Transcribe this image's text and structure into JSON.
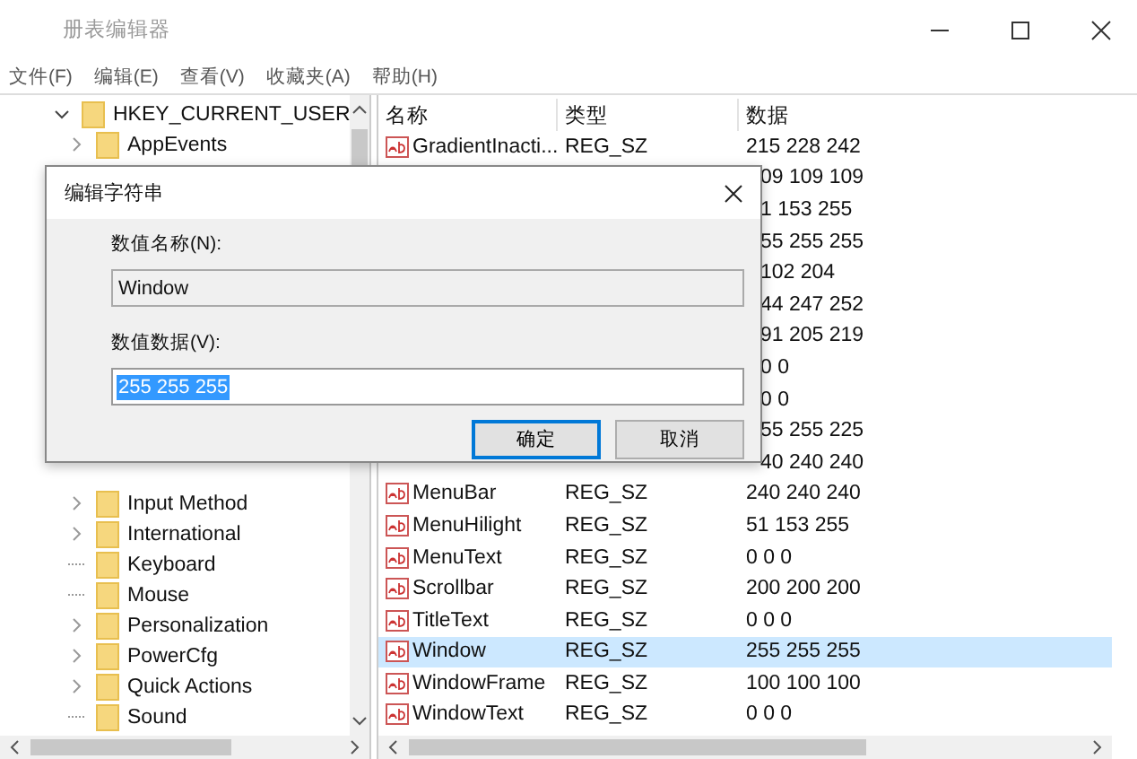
{
  "window": {
    "title": "册表编辑器"
  },
  "menu": [
    "文件(F)",
    "编辑(E)",
    "查看(V)",
    "收藏夹(A)",
    "帮助(H)"
  ],
  "tree": {
    "label": "HKEY_CURRENT_USER",
    "expanded": true,
    "children": [
      {
        "label": "AppEvents",
        "expandable": true
      },
      {
        "label": "Input Method",
        "expandable": true
      },
      {
        "label": "International",
        "expandable": true
      },
      {
        "label": "Keyboard",
        "expandable": false
      },
      {
        "label": "Mouse",
        "expandable": false
      },
      {
        "label": "Personalization",
        "expandable": true
      },
      {
        "label": "PowerCfg",
        "expandable": true
      },
      {
        "label": "Quick Actions",
        "expandable": true
      },
      {
        "label": "Sound",
        "expandable": false
      }
    ]
  },
  "list": {
    "columns": [
      "名称",
      "类型",
      "数据"
    ],
    "rows": [
      {
        "name": "GradientInacti...",
        "type": "REG_SZ",
        "data": "215 228 242",
        "selected": false
      },
      {
        "data": "09 109 109",
        "selected": false
      },
      {
        "data": "1 153 255",
        "selected": false
      },
      {
        "data": "55 255 255",
        "selected": false
      },
      {
        "data": "102 204",
        "selected": false
      },
      {
        "data": "44 247 252",
        "selected": false
      },
      {
        "data": "91 205 219",
        "selected": false
      },
      {
        "data": "0 0",
        "selected": false
      },
      {
        "data": "0 0",
        "selected": false
      },
      {
        "data": "55 255 225",
        "selected": false
      },
      {
        "data": "40 240 240",
        "selected": false
      },
      {
        "name": "MenuBar",
        "type": "REG_SZ",
        "data": "240 240 240",
        "selected": false
      },
      {
        "name": "MenuHilight",
        "type": "REG_SZ",
        "data": "51 153 255",
        "selected": false
      },
      {
        "name": "MenuText",
        "type": "REG_SZ",
        "data": "0 0 0",
        "selected": false
      },
      {
        "name": "Scrollbar",
        "type": "REG_SZ",
        "data": "200 200 200",
        "selected": false
      },
      {
        "name": "TitleText",
        "type": "REG_SZ",
        "data": "0 0 0",
        "selected": false
      },
      {
        "name": "Window",
        "type": "REG_SZ",
        "data": "255 255 255",
        "selected": true
      },
      {
        "name": "WindowFrame",
        "type": "REG_SZ",
        "data": "100 100 100",
        "selected": false
      },
      {
        "name": "WindowText",
        "type": "REG_SZ",
        "data": "0 0 0",
        "selected": false
      }
    ]
  },
  "dialog": {
    "title": "编辑字符串",
    "name_label": "数值名称(N):",
    "name_value": "Window",
    "data_label": "数值数据(V):",
    "data_value": "255 255 255",
    "data_selected": true,
    "buttons": [
      {
        "label": "确定",
        "default": true
      },
      {
        "label": "取消",
        "default": false
      }
    ]
  }
}
